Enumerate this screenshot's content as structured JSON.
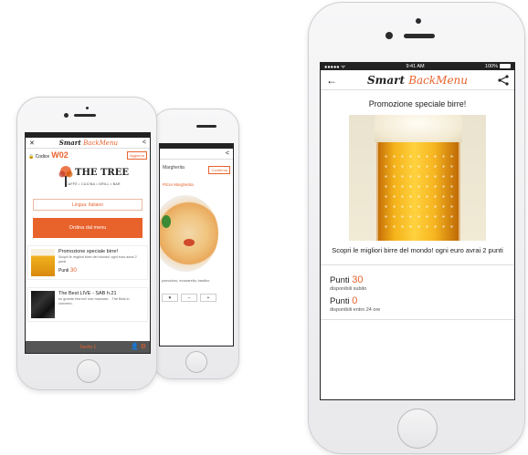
{
  "big_phone": {
    "status": {
      "carrier": "●●●●● ᯤ",
      "time": "9:41 AM",
      "battery": "100%"
    },
    "nav": {
      "back_icon": "back-arrow-icon",
      "logo_smart": "Smart",
      "logo_back": "BackMenu",
      "share_icon": "share-icon"
    },
    "promo": {
      "title": "Promozione speciale birre!",
      "description": "Scopri le migliori birre del mondo! ogni euro avrai 2 punti"
    },
    "points": [
      {
        "label": "Punti",
        "value": "30",
        "sub": "disponibili subito"
      },
      {
        "label": "Punti",
        "value": "0",
        "sub": "disponibili entro 24 ore"
      }
    ]
  },
  "left_phone": {
    "nav": {
      "close_icon": "close-icon",
      "logo_smart": "Smart",
      "logo_back": "BackMenu",
      "share_icon": "share-icon"
    },
    "code_label": "Codice",
    "code_value": "W02",
    "refresh_label": "Aggiorna",
    "venue_name": "THE TREE",
    "venue_sub": "CAFFÈ • CUCINA • GRILL • BAR",
    "language_label": "Lingua: Italiano",
    "order_button": "Ordina dal menu",
    "cards": [
      {
        "title": "Promozione speciale birre!",
        "desc": "Scopri le migliori birre del mondo! ogni euro avrai 2 punti",
        "points_label": "Punti",
        "points_value": "30"
      },
      {
        "title": "The Best LIVE - SAB h.21",
        "desc": "un grande ritorno!! non mancare... The Best in concerto."
      }
    ],
    "footer_tab": "Tavolo 1",
    "colors": {
      "accent": "#e8622c"
    }
  },
  "back_phone": {
    "title": "Margherita",
    "tag": "Conferma",
    "crumb": "Pizze Margherita",
    "caption": "pomodoro, mozzarella, basilico",
    "controls": [
      "♥",
      "–",
      "+"
    ]
  }
}
